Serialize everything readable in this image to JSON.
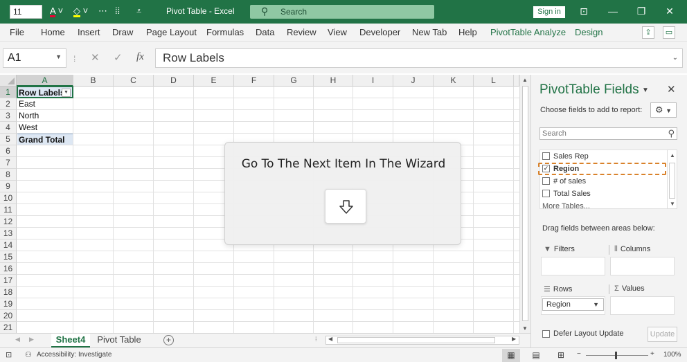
{
  "titlebar": {
    "font_size": "11",
    "title": "Pivot Table  -  Excel",
    "search_placeholder": "Search",
    "sign_in": "Sign in",
    "accent": "#217346"
  },
  "menu": {
    "items": [
      "File",
      "Home",
      "Insert",
      "Draw",
      "Page Layout",
      "Formulas",
      "Data",
      "Review",
      "View",
      "Developer",
      "New Tab",
      "Help",
      "PivotTable Analyze",
      "Design"
    ]
  },
  "formula_bar": {
    "name_box": "A1",
    "fx": "fx",
    "content": "Row Labels"
  },
  "grid": {
    "columns": [
      "A",
      "B",
      "C",
      "D",
      "E",
      "F",
      "G",
      "H",
      "I",
      "J",
      "K",
      "L"
    ],
    "rows": [
      "1",
      "2",
      "3",
      "4",
      "5",
      "6",
      "7",
      "8",
      "9",
      "10",
      "11",
      "12",
      "13",
      "14",
      "15",
      "16",
      "17",
      "18",
      "19",
      "20",
      "21"
    ],
    "cells": {
      "a1": "Row Labels",
      "a2": "East",
      "a3": "North",
      "a4": "West",
      "a5": "Grand Total"
    }
  },
  "wizard": {
    "text": "Go To The Next Item In The Wizard",
    "icon": "arrow-down-icon"
  },
  "tabs": {
    "items": [
      "Sheet4",
      "Pivot Table"
    ],
    "active": "Sheet4"
  },
  "status": {
    "accessibility": "Accessibility: Investigate",
    "zoom": "100%"
  },
  "pane": {
    "title": "PivotTable Fields",
    "subtitle": "Choose fields to add to report:",
    "search_placeholder": "Search",
    "fields": [
      {
        "label": "Sales Rep",
        "checked": false
      },
      {
        "label": "Region",
        "checked": true
      },
      {
        "label": "# of sales",
        "checked": false
      },
      {
        "label": "Total Sales",
        "checked": false
      }
    ],
    "more_tables": "More Tables...",
    "drag_hint": "Drag fields between areas below:",
    "areas": {
      "filters": "Filters",
      "columns": "Columns",
      "rows": "Rows",
      "values": "Values"
    },
    "rows_field": "Region",
    "defer": "Defer Layout Update",
    "update": "Update"
  }
}
